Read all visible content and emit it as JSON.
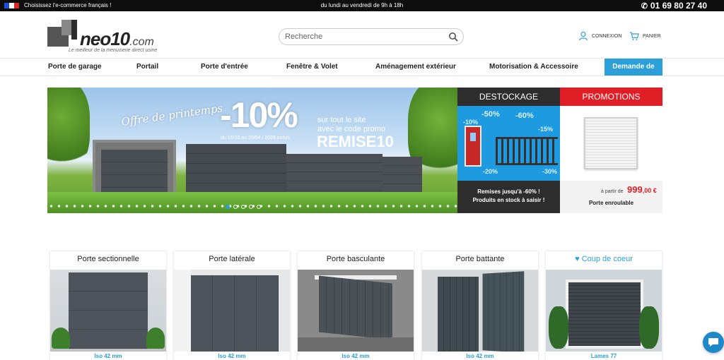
{
  "topbar": {
    "left_text": "Choisissez l'e-commerce français !",
    "center_text": "du lundi au vendredi de 9h à 18h",
    "phone": "01 69 80 27 40",
    "flag_colors": [
      "#1d4ed8",
      "#ffffff",
      "#dc2626"
    ]
  },
  "header": {
    "logo_name": "neo10",
    "logo_tld": ".com",
    "logo_tagline": "Le meilleur de la menuiserie direct usine",
    "search_placeholder": "Recherche",
    "login_label": "CONNEXION",
    "cart_label": "PANIER"
  },
  "nav": {
    "items": [
      "Porte de garage",
      "Portail",
      "Porte d'entrée",
      "Fenêtre & Volet",
      "Aménagement extérieur",
      "Motorisation & Accessoire"
    ],
    "cta": "Demande de devis",
    "accent_color": "#2a9fd8"
  },
  "hero": {
    "script": "Offre de printemps",
    "discount": "-10%",
    "dates": "du 16/03 au 20/04 / 2026 inclus",
    "line1": "sur tout le site",
    "line2": "avec le code promo",
    "code": "REMISE10",
    "slides": 5,
    "active_slide": 1
  },
  "destockage": {
    "title": "DESTOCKAGE",
    "discounts": [
      "-50%",
      "-60%",
      "-10%",
      "-15%",
      "-20%",
      "-30%"
    ],
    "footer_line1": "Remises jusqu'à -60% !",
    "footer_line2": "Produits en stock à saisir !"
  },
  "promotions": {
    "title": "PROMOTIONS",
    "price_prefix": "à partir de",
    "price_main": "999",
    "price_cents": ",00 €",
    "product": "Porte enroulable",
    "color": "#e01e26"
  },
  "categories": [
    {
      "title": "Porte sectionnelle",
      "sub": "Iso 42 mm",
      "heart": false
    },
    {
      "title": "Porte latérale",
      "sub": "Iso 42 mm",
      "heart": false
    },
    {
      "title": "Porte basculante",
      "sub": "Iso 42 mm",
      "heart": false
    },
    {
      "title": "Porte battante",
      "sub": "Iso 42 mm",
      "heart": false
    },
    {
      "title": "Coup de coeur",
      "sub": "Lames 77",
      "heart": true
    }
  ]
}
